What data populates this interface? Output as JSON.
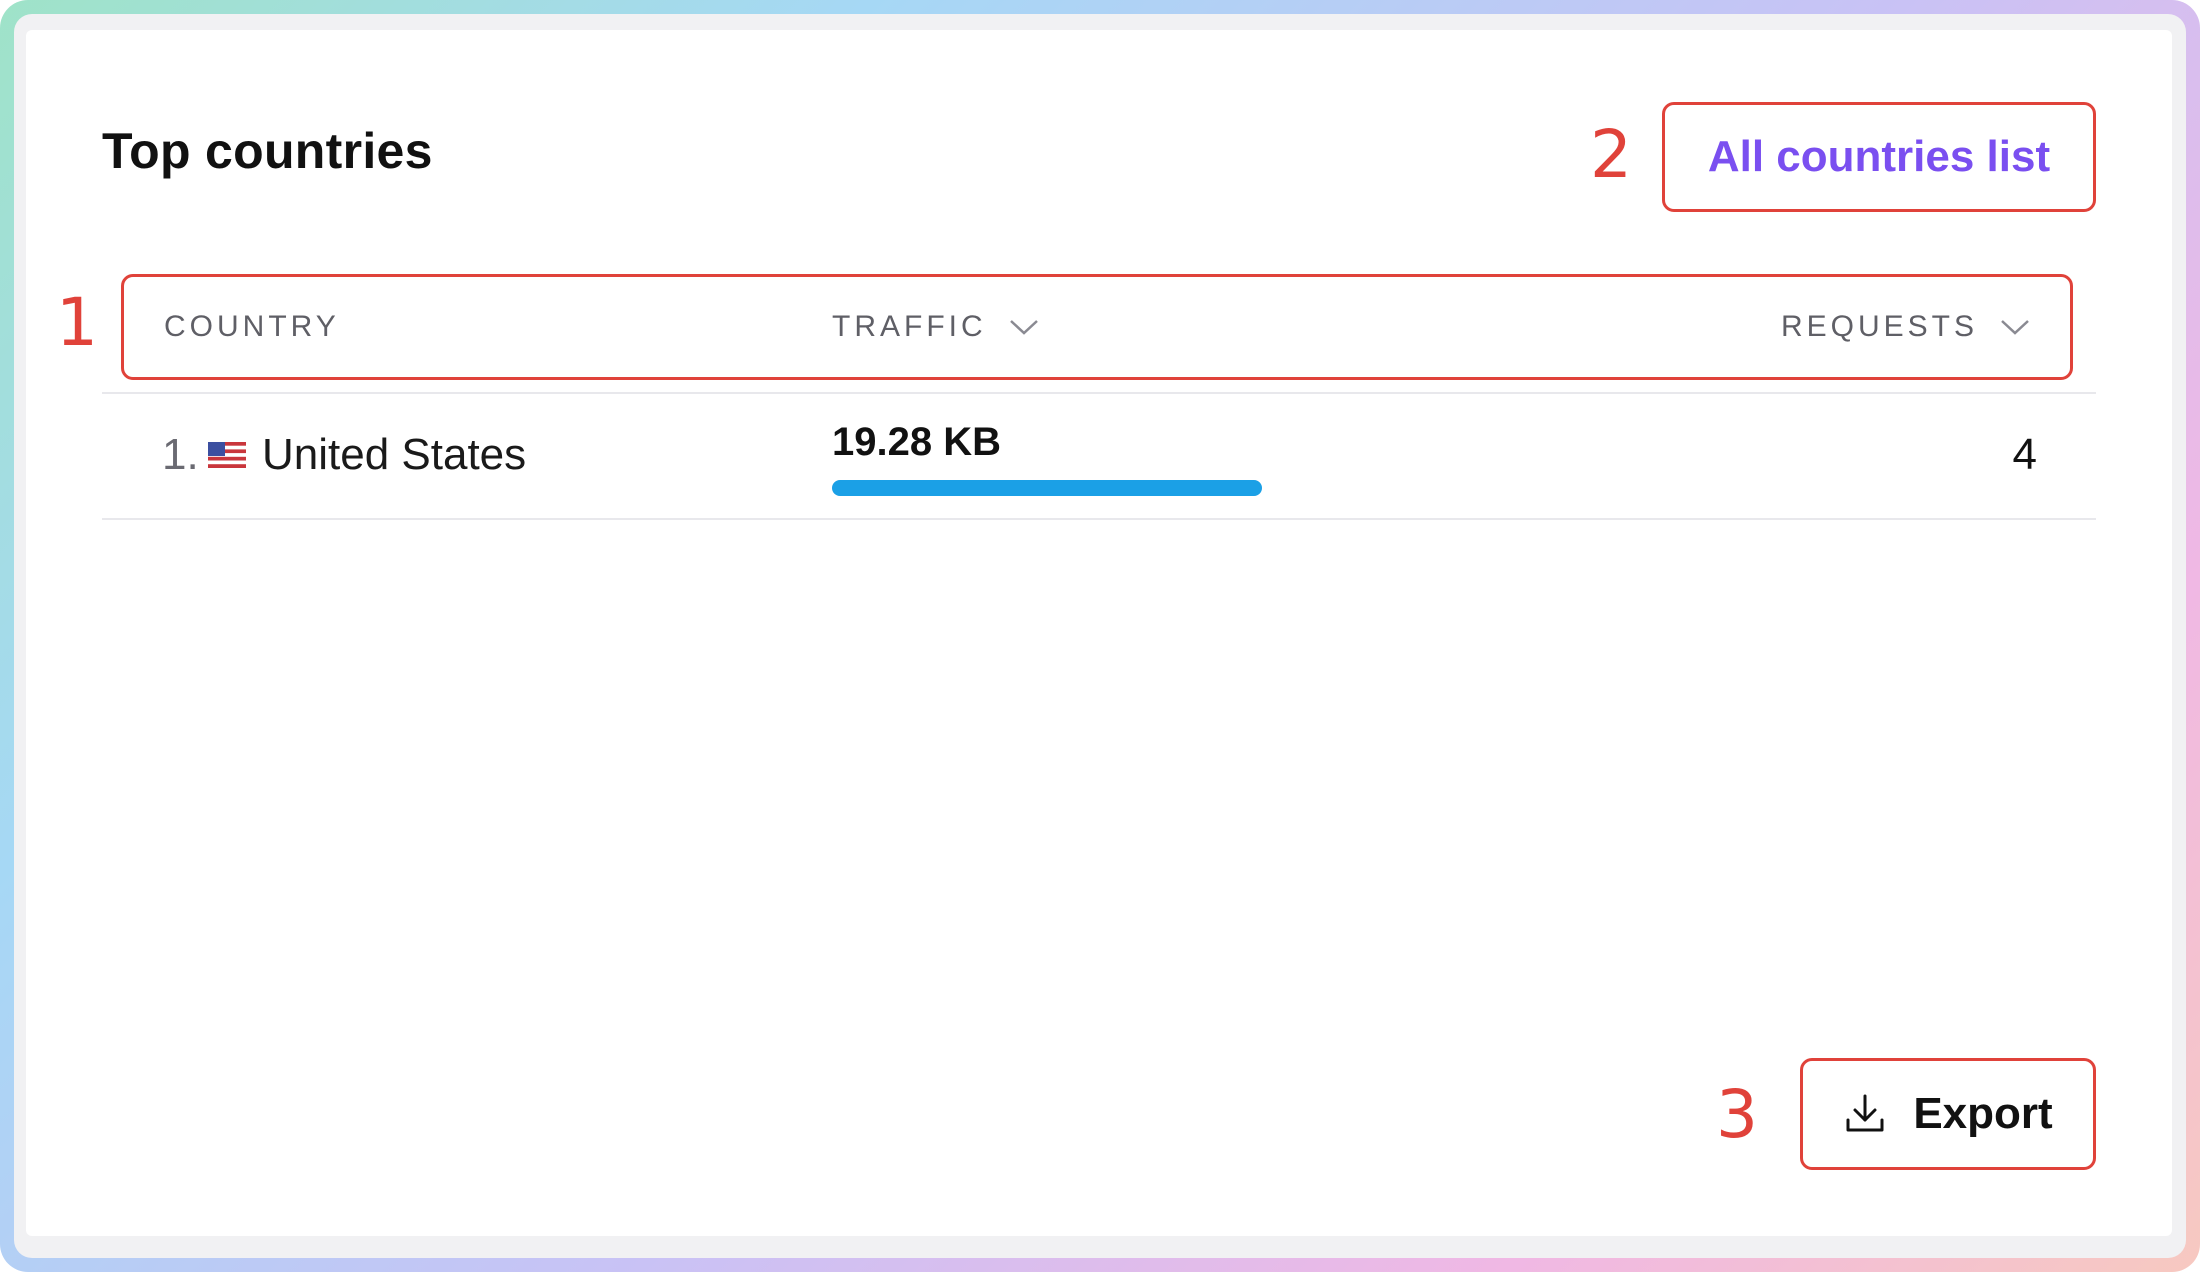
{
  "card": {
    "title": "Top countries",
    "all_countries_button": "All countries list",
    "markers": [
      "1",
      "2",
      "3"
    ]
  },
  "table": {
    "columns": [
      {
        "label": "COUNTRY",
        "sortable": false
      },
      {
        "label": "TRAFFIC",
        "sortable": true,
        "icon": "chevron-down-icon"
      },
      {
        "label": "REQUESTS",
        "sortable": true,
        "icon": "chevron-down-icon"
      }
    ],
    "rows": [
      {
        "rank": "1.",
        "flag": "us-flag-icon",
        "country": "United States",
        "traffic": "19.28 KB",
        "traffic_share": 1.0,
        "requests": "4"
      }
    ]
  },
  "export_button": {
    "label": "Export",
    "icon": "download-icon"
  },
  "colors": {
    "accent": "#7a4ff0",
    "annotation": "#e0423a",
    "bar": "#1ba0e6"
  }
}
